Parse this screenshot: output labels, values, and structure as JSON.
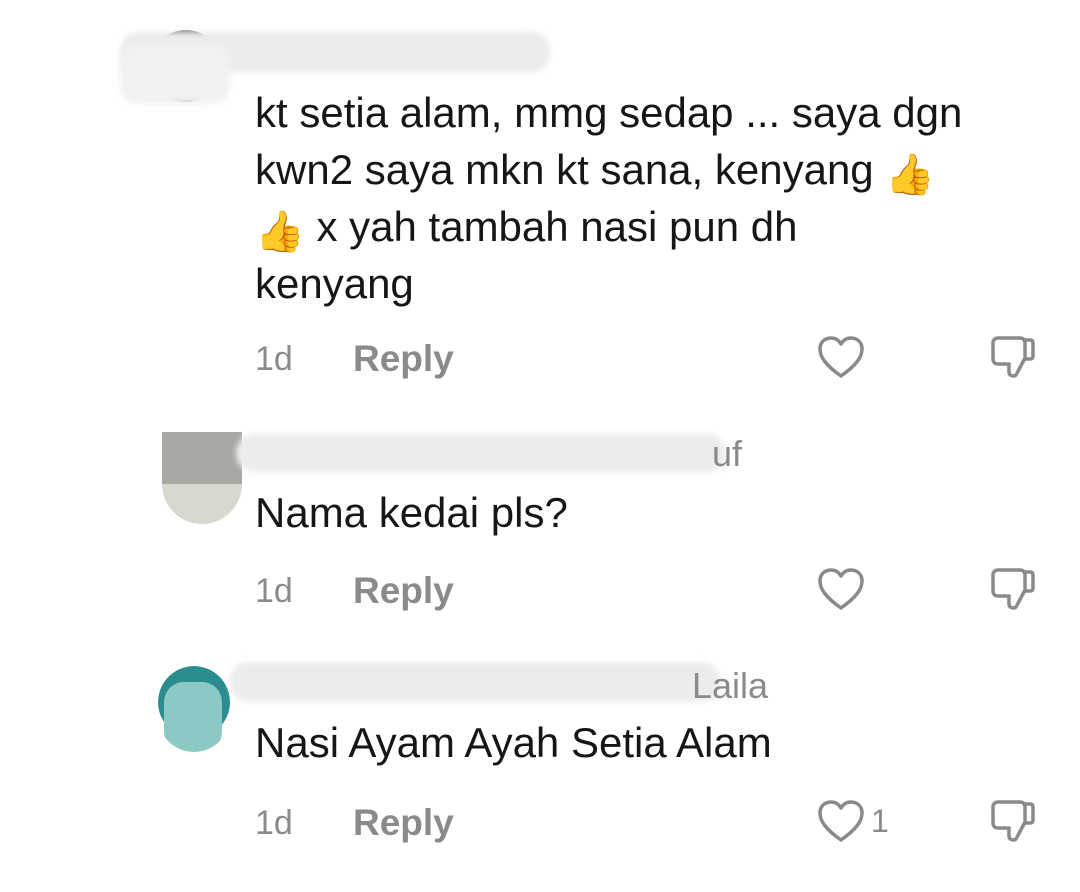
{
  "comments": [
    {
      "username_visible": "",
      "text_lines": [
        "kt setia alam, mmg sedap ... saya dgn",
        "kwn2 saya mkn kt sana, kenyang",
        "x yah tambah nasi pun dh",
        "kenyang"
      ],
      "emoji": "👍",
      "age": "1d",
      "reply_label": "Reply",
      "like_count": ""
    },
    {
      "username_visible": "uf",
      "text_lines": [
        "Nama kedai pls?"
      ],
      "age": "1d",
      "reply_label": "Reply",
      "like_count": ""
    },
    {
      "username_visible": "Laila",
      "text_lines": [
        "Nasi Ayam Ayah Setia Alam"
      ],
      "age": "1d",
      "reply_label": "Reply",
      "like_count": "1"
    }
  ],
  "icons": {
    "like": "heart-outline-icon",
    "dislike": "thumbs-down-outline-icon",
    "emoji": "thumbs-up-emoji"
  },
  "colors": {
    "text": "#161616",
    "muted": "#8a8a8a",
    "blur_overlay": "#eeeeee",
    "emoji": "#f2b01e"
  }
}
